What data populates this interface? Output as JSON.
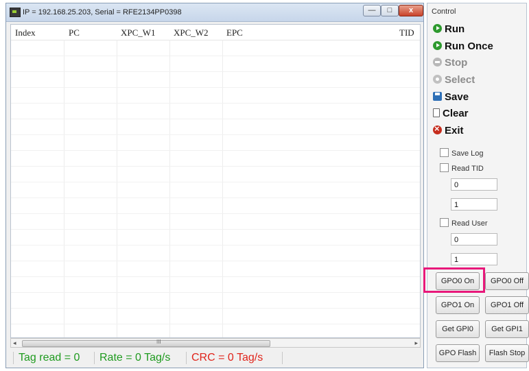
{
  "window": {
    "title": "IP = 192.168.25.203, Serial = RFE2134PP0398",
    "minimize_label": "—",
    "maximize_label": "□",
    "close_label": "x"
  },
  "table": {
    "columns": [
      "Index",
      "PC",
      "XPC_W1",
      "XPC_W2",
      "EPC",
      "TID"
    ],
    "rows": []
  },
  "scrollbar": {
    "left_arrow": "◂",
    "right_arrow": "▸",
    "grip": "III"
  },
  "status": {
    "tag_read": "Tag read = 0",
    "rate": "Rate = 0 Tag/s",
    "crc": "CRC = 0 Tag/s",
    "colors": {
      "tag_read": "#1e9a1e",
      "rate": "#1e9a1e",
      "crc": "#e0241b"
    }
  },
  "control": {
    "title": "Control",
    "commands": {
      "run": "Run",
      "run_once": "Run Once",
      "stop": "Stop",
      "select": "Select",
      "save": "Save",
      "clear": "Clear",
      "exit": "Exit"
    },
    "save_log_label": "Save Log",
    "read_tid_label": "Read TID",
    "read_tid_start": "0",
    "read_tid_length": "1",
    "read_user_label": "Read User",
    "read_user_start": "0",
    "read_user_length": "1",
    "gpo0_on": "GPO0 On",
    "gpo0_off": "GPO0 Off",
    "gpo1_on": "GPO1 On",
    "gpo1_off": "GPO1 Off",
    "get_gpi0": "Get GPI0",
    "get_gpi1": "Get GPI1",
    "gpo_flash": "GPO Flash",
    "flash_stop": "Flash Stop"
  },
  "highlight_color": "#e8187a"
}
